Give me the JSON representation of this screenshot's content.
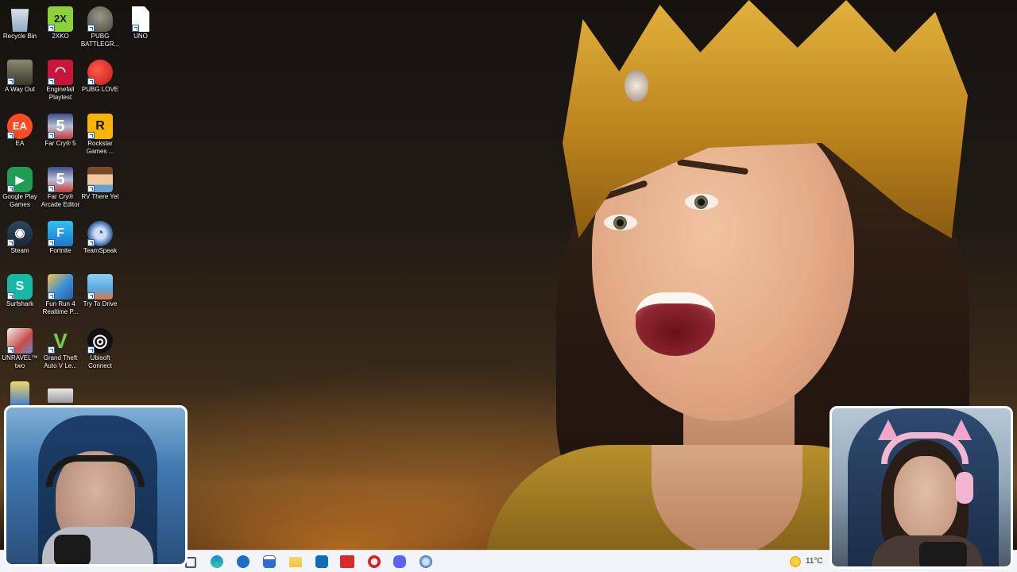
{
  "desktop_icons": [
    {
      "label": "Recycle Bin",
      "icon": "recycle-bin-icon",
      "color": "#8fa9c4"
    },
    {
      "label": "2XKO",
      "icon": "2xko-icon",
      "color": "#8bd23a"
    },
    {
      "label": "PUBG BATTLEGR...",
      "icon": "pubg-battlegrounds-icon",
      "color": "#6a6a5a"
    },
    {
      "label": "UNO",
      "icon": "uno-file-icon",
      "color": "#ffffff"
    },
    {
      "label": "A Way Out",
      "icon": "a-way-out-icon",
      "color": "#4b4a3a"
    },
    {
      "label": "Enginefall Playtest",
      "icon": "enginefall-icon",
      "color": "#c8163a"
    },
    {
      "label": "PUBG LOVE",
      "icon": "pubg-love-icon",
      "color": "#e02a2a"
    },
    {
      "label": "EA",
      "icon": "ea-icon",
      "color": "#ff4b23"
    },
    {
      "label": "Far Cry® 5",
      "icon": "far-cry-5-icon",
      "color": "#2b3b6a"
    },
    {
      "label": "Rockstar Games ...",
      "icon": "rockstar-icon",
      "color": "#f7b500"
    },
    {
      "label": "Google Play Games",
      "icon": "google-play-games-icon",
      "color": "#1f9d55"
    },
    {
      "label": "Far Cry® Arcade Editor",
      "icon": "far-cry-arcade-icon",
      "color": "#2b3b6a"
    },
    {
      "label": "RV There Yet",
      "icon": "rv-there-yet-icon",
      "color": "#c9733e"
    },
    {
      "label": "Steam",
      "icon": "steam-icon",
      "color": "#1b2838"
    },
    {
      "label": "Fortnite",
      "icon": "fortnite-icon",
      "color": "#1aa6e8"
    },
    {
      "label": "TeamSpeak",
      "icon": "teamspeak-icon",
      "color": "#2d5a9e"
    },
    {
      "label": "Surfshark",
      "icon": "surfshark-icon",
      "color": "#16b8a6"
    },
    {
      "label": "Fun Run 4 Realtime P...",
      "icon": "fun-run-4-icon",
      "color": "#3a8fd9"
    },
    {
      "label": "Try To Drive",
      "icon": "try-to-drive-icon",
      "color": "#5aa7e0"
    },
    {
      "label": "UNRAVEL™ two",
      "icon": "unravel-two-icon",
      "color": "#c84b4b"
    },
    {
      "label": "Grand Theft Auto V Le...",
      "icon": "gta-v-icon",
      "color": "#3a7d2a"
    },
    {
      "label": "Ubisoft Connect",
      "icon": "ubisoft-connect-icon",
      "color": "#1a1a1a"
    },
    {
      "label": "",
      "icon": "folder-file-icon",
      "color": "#d9b44a"
    },
    {
      "label": "",
      "icon": "drive-image-icon",
      "color": "#cfcfcf"
    }
  ],
  "glyphs": {
    "2xko": "2X",
    "uno": "",
    "ea": "EA",
    "far_cry_5": "5",
    "far_cry_arcade": "5",
    "rockstar": "R",
    "fortnite": "F",
    "gta": "V",
    "steam": "◉",
    "ubisoft": "◎",
    "teamspeak": "◔",
    "surfshark": "S",
    "google_play": "▶",
    "enginefall": "◠"
  },
  "taskbar": {
    "apps": [
      {
        "name": "task-view-icon",
        "color": "#555555"
      },
      {
        "name": "edge-icon",
        "color": "#1c8fd6"
      },
      {
        "name": "steam-taskbar-icon",
        "color": "#1b6fbf"
      },
      {
        "name": "store-icon",
        "color": "#2d6fd1"
      },
      {
        "name": "file-explorer-icon",
        "color": "#f2c33b"
      },
      {
        "name": "outlook-icon",
        "color": "#0f6cbd"
      },
      {
        "name": "video-editor-icon",
        "color": "#d92a2a"
      },
      {
        "name": "opera-icon",
        "color": "#e0201f"
      },
      {
        "name": "discord-icon",
        "color": "#5865f2"
      },
      {
        "name": "teamspeak-taskbar-icon",
        "color": "#3d6fb3"
      }
    ],
    "weather": {
      "temp": "11°C",
      "icon": "weather-sun-icon"
    }
  }
}
